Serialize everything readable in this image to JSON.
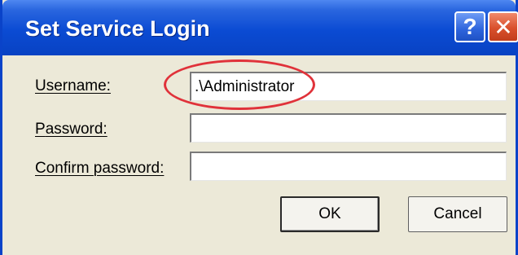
{
  "window": {
    "title": "Set Service Login",
    "help_glyph": "?",
    "close_glyph": "✕"
  },
  "fields": {
    "username": {
      "label": "Username:",
      "accel": "U",
      "rest": "sername:",
      "value": ".\\Administrator"
    },
    "password": {
      "label": "Password:",
      "accel": "P",
      "rest": "assword:",
      "value": ""
    },
    "confirm": {
      "label": "Confirm password:",
      "accel": "C",
      "rest": "onfirm password:",
      "value": ""
    }
  },
  "buttons": {
    "ok": "OK",
    "cancel": "Cancel"
  },
  "colors": {
    "titlebar": "#0b4bd3",
    "dialog_bg": "#ece9d8",
    "annotation": "#e0323a"
  },
  "icons": {
    "help": "help-icon",
    "close": "close-icon"
  }
}
